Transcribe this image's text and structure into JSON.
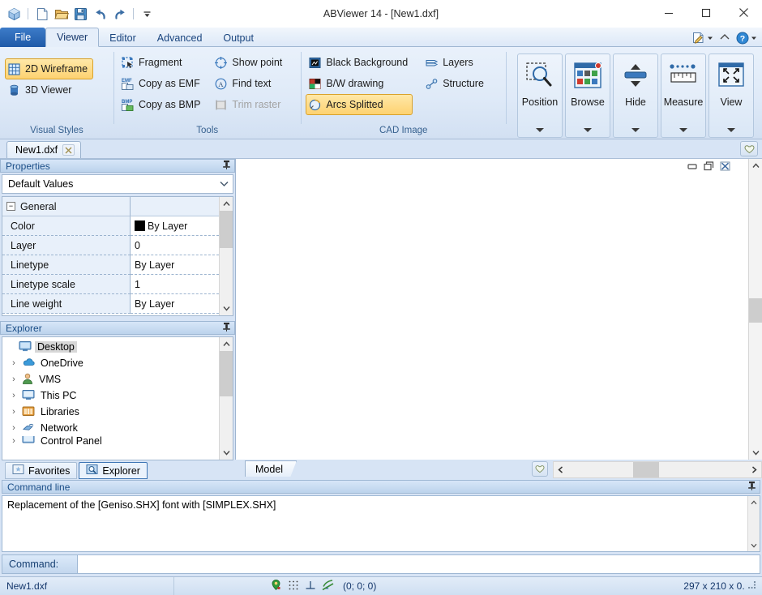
{
  "window": {
    "title": "ABViewer 14 - [New1.dxf]",
    "minimize_label": "Minimize",
    "maximize_label": "Maximize",
    "close_label": "Close"
  },
  "quick_access": {
    "items": [
      {
        "name": "app-logo-icon",
        "label": "ABViewer"
      },
      {
        "name": "new-file-icon",
        "label": "New"
      },
      {
        "name": "open-file-icon",
        "label": "Open"
      },
      {
        "name": "save-file-icon",
        "label": "Save"
      },
      {
        "name": "undo-icon",
        "label": "Undo"
      },
      {
        "name": "redo-icon",
        "label": "Redo"
      },
      {
        "name": "customize-quick-access-icon",
        "label": "Customize Quick Access Toolbar"
      }
    ]
  },
  "ribbon": {
    "tabs": [
      {
        "label": "File",
        "active": false,
        "file": true
      },
      {
        "label": "Viewer",
        "active": true,
        "file": false
      },
      {
        "label": "Editor",
        "active": false,
        "file": false
      },
      {
        "label": "Advanced",
        "active": false,
        "file": false
      },
      {
        "label": "Output",
        "active": false,
        "file": false
      }
    ],
    "right_icons": [
      {
        "name": "signature-pen-icon",
        "label": "Markup"
      },
      {
        "name": "collapse-ribbon-icon",
        "label": "Minimize the Ribbon"
      },
      {
        "name": "help-icon",
        "label": "Help"
      }
    ],
    "groups": [
      {
        "label": "Visual Styles",
        "items": [
          {
            "label": "2D Wireframe",
            "icon": "wireframe-grid-icon",
            "checked": true,
            "disabled": false
          },
          {
            "label": "3D Viewer",
            "icon": "cylinder-3d-icon",
            "checked": false,
            "disabled": false
          }
        ]
      },
      {
        "label": "Tools",
        "col1": [
          {
            "label": "Fragment",
            "icon": "fragment-select-icon",
            "checked": false,
            "disabled": false
          },
          {
            "label": "Copy as EMF",
            "icon": "copy-emf-icon",
            "checked": false,
            "disabled": false
          },
          {
            "label": "Copy as BMP",
            "icon": "copy-bmp-icon",
            "checked": false,
            "disabled": false
          }
        ],
        "col2": [
          {
            "label": "Show point",
            "icon": "show-point-icon",
            "checked": false,
            "disabled": false
          },
          {
            "label": "Find text",
            "icon": "find-text-icon",
            "checked": false,
            "disabled": false
          },
          {
            "label": "Trim raster",
            "icon": "trim-raster-icon",
            "checked": false,
            "disabled": true
          }
        ]
      },
      {
        "label": "CAD Image",
        "col1": [
          {
            "label": "Black Background",
            "icon": "black-background-icon",
            "checked": false,
            "disabled": false
          },
          {
            "label": "B/W drawing",
            "icon": "bw-drawing-icon",
            "checked": false,
            "disabled": false
          },
          {
            "label": "Arcs Splitted",
            "icon": "arcs-splitted-icon",
            "checked": true,
            "disabled": false
          }
        ],
        "col2": [
          {
            "label": "Layers",
            "icon": "layers-icon",
            "checked": false,
            "disabled": false
          },
          {
            "label": "Structure",
            "icon": "structure-icon",
            "checked": false,
            "disabled": false
          }
        ]
      }
    ],
    "big_buttons": [
      {
        "label": "Position",
        "icon": "position-zoom-icon"
      },
      {
        "label": "Browse",
        "icon": "browse-thumbnails-icon"
      },
      {
        "label": "Hide",
        "icon": "hide-icon"
      },
      {
        "label": "Measure",
        "icon": "measure-ruler-icon"
      },
      {
        "label": "View",
        "icon": "view-fullscreen-icon"
      }
    ]
  },
  "doc_tabs": {
    "tabs": [
      {
        "label": "New1.dxf"
      }
    ],
    "close_label": "Close document",
    "favorites_button": "favorites-heart-icon"
  },
  "properties_panel": {
    "title": "Properties",
    "pin_label": "Auto Hide",
    "selector_value": "Default Values",
    "group_label": "General",
    "rows": [
      {
        "name": "Color",
        "value": "By Layer",
        "swatch": "#000000"
      },
      {
        "name": "Layer",
        "value": "0",
        "swatch": null
      },
      {
        "name": "Linetype",
        "value": "By Layer",
        "swatch": null
      },
      {
        "name": "Linetype scale",
        "value": "1",
        "swatch": null
      },
      {
        "name": "Line weight",
        "value": "By Layer",
        "swatch": null
      }
    ]
  },
  "explorer_panel": {
    "title": "Explorer",
    "pin_label": "Auto Hide",
    "nodes": [
      {
        "label": "Desktop",
        "icon": "desktop-icon",
        "arrow": "",
        "selected": true,
        "indent": 0
      },
      {
        "label": "OneDrive",
        "icon": "onedrive-cloud-icon",
        "arrow": "›",
        "selected": false,
        "indent": 1
      },
      {
        "label": "VMS",
        "icon": "user-account-icon",
        "arrow": "›",
        "selected": false,
        "indent": 1
      },
      {
        "label": "This PC",
        "icon": "this-pc-icon",
        "arrow": "›",
        "selected": false,
        "indent": 1
      },
      {
        "label": "Libraries",
        "icon": "libraries-folder-icon",
        "arrow": "›",
        "selected": false,
        "indent": 1
      },
      {
        "label": "Network",
        "icon": "network-icon",
        "arrow": "›",
        "selected": false,
        "indent": 1
      },
      {
        "label": "Control Panel",
        "icon": "control-panel-icon",
        "arrow": "›",
        "selected": false,
        "indent": 1
      }
    ],
    "tabs": [
      {
        "label": "Favorites",
        "icon": "favorites-star-icon",
        "active": false
      },
      {
        "label": "Explorer",
        "icon": "explorer-search-icon",
        "active": true
      }
    ]
  },
  "drawing_area": {
    "mdi_minimize": "Minimize",
    "mdi_restore": "Restore",
    "mdi_close": "Close",
    "model_tab": "Model",
    "favorites_button": "favorites-heart-icon"
  },
  "command_line": {
    "title": "Command line",
    "pin_label": "Auto Hide",
    "output_text": "Replacement of the [Geniso.SHX] font with [SIMPLEX.SHX]",
    "prompt_label": "Command:",
    "input_value": ""
  },
  "status_bar": {
    "file_name": "New1.dxf",
    "icons": [
      {
        "name": "osnap-icon",
        "label": "Object Snap"
      },
      {
        "name": "grid-snap-icon",
        "label": "Grid Snap"
      },
      {
        "name": "ortho-icon",
        "label": "Ortho"
      },
      {
        "name": "polar-tracking-icon",
        "label": "Polar Tracking"
      }
    ],
    "coordinates": "(0; 0; 0)",
    "dimensions": "297 x 210 x 0."
  },
  "colors": {
    "accent_blue": "#1f5aa8",
    "ribbon_bg": "#dfeaf8",
    "panel_bg": "#d7e4f5",
    "checked_gold": "#fdd271",
    "canvas": "#ffffff"
  }
}
